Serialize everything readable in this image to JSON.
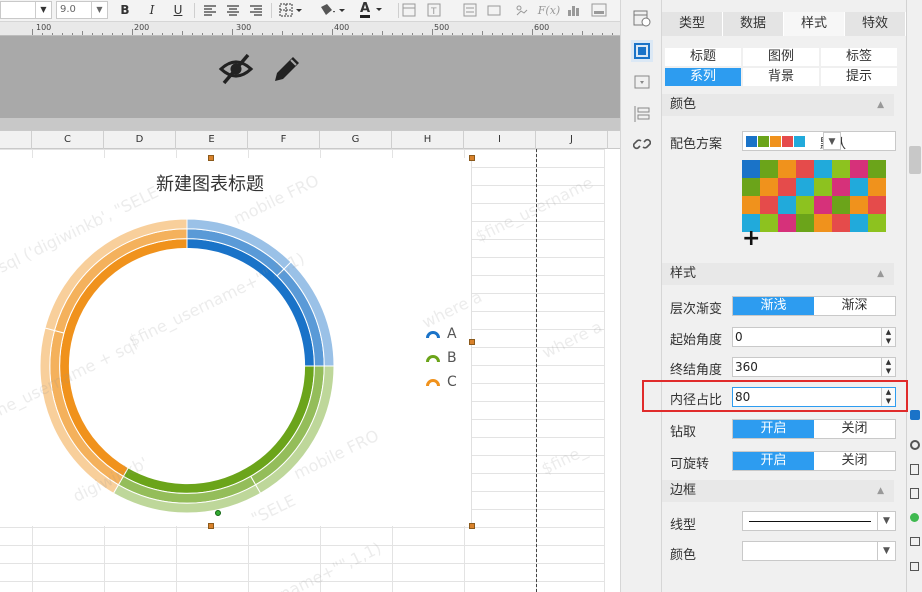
{
  "toolbar": {
    "font_size": "9.0",
    "bold": "B",
    "italic": "I",
    "underline": "U",
    "text_color_glyph": "A",
    "formula": "F(x)"
  },
  "ruler": {
    "labels": [
      "100",
      "200",
      "300",
      "400",
      "500",
      "600"
    ]
  },
  "columns": [
    "C",
    "D",
    "E",
    "F",
    "G",
    "H",
    "I",
    "J"
  ],
  "chart": {
    "title": "新建图表标题",
    "legend": [
      "A",
      "B",
      "C"
    ],
    "series_colors": {
      "A": "#1a73c8",
      "B": "#6ba41a",
      "C": "#f0921c"
    }
  },
  "chart_data": {
    "type": "multi-level pie (sunburst)",
    "title": "新建图表标题",
    "categories": [
      "A",
      "B",
      "C"
    ],
    "inner_radius_percent": 80,
    "start_angle": 0,
    "end_angle": 360,
    "angles": {
      "A": [
        0,
        90
      ],
      "B": [
        90,
        210
      ],
      "C": [
        210,
        360
      ]
    },
    "rings": 3
  },
  "watermark": {
    "texts": [
      "sql ('digiwinkb', \"SELE",
      "$fine_username+\"\",1,1)",
      "where a",
      "mobile FRO",
      "$fine_username",
      "mobile FRO",
      "fine_username + sql",
      "digiwinkb'",
      "\"SELE",
      "$fine_",
      "where a",
      "ername+\"\",1,1)"
    ]
  },
  "panel": {
    "tabs": [
      "类型",
      "数据",
      "样式",
      "特效"
    ],
    "subtabs": [
      "标题",
      "图例",
      "标签",
      "系列",
      "背景",
      "提示"
    ],
    "sections": {
      "color": "颜色",
      "style": "样式",
      "border": "边框"
    },
    "color_scheme_label": "配色方案",
    "color_scheme_value": "默认",
    "add_glyph": "+",
    "gradient_label": "层次渐变",
    "gradient_options": [
      "渐浅",
      "渐深"
    ],
    "start_angle_label": "起始角度",
    "start_angle_value": "0",
    "end_angle_label": "终结角度",
    "end_angle_value": "360",
    "inner_radius_label": "内径占比",
    "inner_radius_value": "80",
    "drill_label": "钻取",
    "drill_options": [
      "开启",
      "关闭"
    ],
    "rotate_label": "可旋转",
    "rotate_options": [
      "开启",
      "关闭"
    ],
    "line_type_label": "线型",
    "border_color_label": "颜色"
  },
  "palette": [
    "#1a73c8",
    "#6ba41a",
    "#f0921c",
    "#e54b4b",
    "#21aadb",
    "#8dc21f",
    "#d6317a",
    "#6ba41a",
    "#6ba41a",
    "#f0921c",
    "#e54b4b",
    "#21aadb",
    "#8dc21f",
    "#d6317a",
    "#21aadb",
    "#f0921c",
    "#f0921c",
    "#e54b4b",
    "#21aadb",
    "#8dc21f",
    "#d6317a",
    "#6ba41a",
    "#f0921c",
    "#e54b4b",
    "#21aadb",
    "#8dc21f",
    "#d6317a",
    "#6ba41a",
    "#f0921c",
    "#e54b4b",
    "#21aadb",
    "#8dc21f"
  ]
}
